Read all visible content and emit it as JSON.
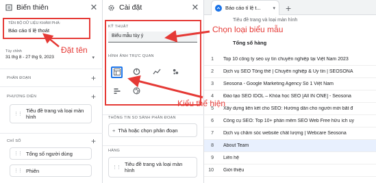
{
  "left_panel": {
    "title": "Biến thiên",
    "exploration_name_label": "TÊN BỘ DỮ LIỆU KHÁM PHÁ:",
    "exploration_name_value": "Báo cáo tỉ lệ thoát",
    "date_label": "Tùy chỉnh",
    "date_range": "31 thg 8 - 27 thg 9, 2023",
    "segments_label": "PHÂN ĐOẠN",
    "dimensions_label": "PHƯƠNG DIỆN",
    "dimension_item": "Tiêu đề trang và loại màn hình",
    "metrics_label": "CHỈ SỐ",
    "metric_items": [
      "Tổng số người dùng",
      "Phiên"
    ]
  },
  "mid_panel": {
    "title": "Cài đặt",
    "technique_label": "KỸ THUẬT",
    "technique_value": "Biểu mẫu tùy ý",
    "visualization_label": "HÌNH ẢNH TRỰC QUAN",
    "segment_compare_label": "THÔNG TIN SO SÁNH PHÂN ĐOẠN",
    "segment_drop_text": "Thả hoặc chọn phân đoạn",
    "rows_label": "HÀNG",
    "row_item": "Tiêu đề trang và loại màn hình"
  },
  "right_panel": {
    "tab_label": "Báo cáo tỉ lệ t...",
    "col_header_dim": "Tiêu đề trang và loại màn hình",
    "col_header_metric": "Tổng số hàng",
    "rows": [
      {
        "n": "1",
        "t": "Top 10 công ty seo uy tín chuyên nghiệp tại Việt Nam 2023"
      },
      {
        "n": "2",
        "t": "Dịch vụ SEO Tổng thể | Chuyên nghiệp & Uy tín | SEOSONA"
      },
      {
        "n": "3",
        "t": "Seosona - Google Marketing Agency Số 1 Việt Nam"
      },
      {
        "n": "4",
        "t": "Đào tạo SEO IDOL – Khóa học SEO [All IN ONE] - Seosona"
      },
      {
        "n": "5",
        "t": "Xây dựng liên kết cho SEO: Hướng dẫn cho người mới bắt đ"
      },
      {
        "n": "6",
        "t": "Công cụ SEO: Top 10+ phần mềm SEO Web Free hữu ích uy"
      },
      {
        "n": "7",
        "t": "Dịch vụ chăm sóc website chất lượng | Webcare Seosona"
      },
      {
        "n": "8",
        "t": "About Team"
      },
      {
        "n": "9",
        "t": "Liên hệ"
      },
      {
        "n": "10",
        "t": "Giới thiệu"
      }
    ]
  },
  "annotations": {
    "name_note": "Đặt tên",
    "technique_note": "Chọn loại biểu mẫu",
    "viz_note": "Kiểu thể hiện"
  },
  "colors": {
    "annotation": "#e53935",
    "accent": "#1a73e8"
  }
}
